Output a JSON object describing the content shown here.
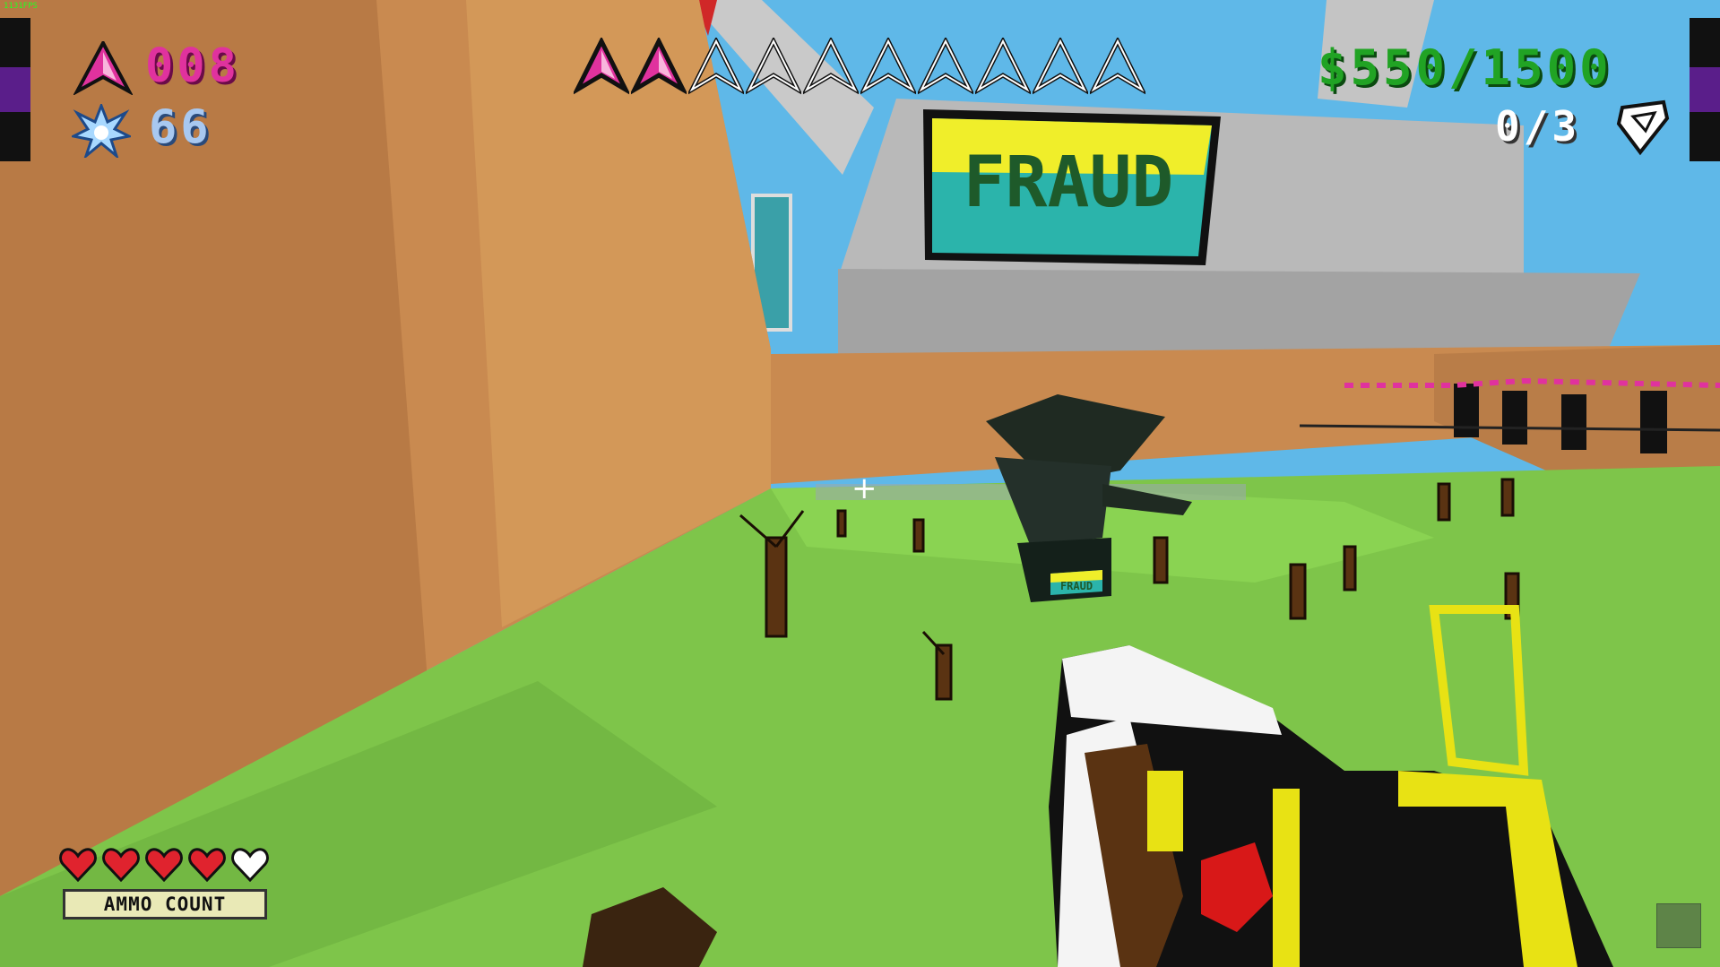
{
  "hud": {
    "fps": "1131FPS",
    "shard_count": "008",
    "ammo_count": "66",
    "money": "$550/1500",
    "objectives": "0/3",
    "health": {
      "hearts_full": 4,
      "hearts_total": 5
    },
    "ammo_label": "AMMO COUNT",
    "shard_meter": {
      "filled": 2,
      "total": 10
    },
    "crosshair": "+"
  },
  "scene": {
    "billboard_text": "FRAUD",
    "pedestal_text": "FRAUD"
  },
  "icons": {
    "shard": "shard-icon",
    "ammo": "energy-burst-icon",
    "objective": "gem-icon",
    "heart": "heart-icon"
  },
  "colors": {
    "shard": "#e0329e",
    "ammo": "#a8c8f0",
    "money": "#21a324",
    "objective": "#ffffff",
    "heart": "#e0232e",
    "sky": "#5fb8e8",
    "grass": "#7ec54a",
    "dirt": "#c98a50",
    "gun_yellow": "#e8e214"
  }
}
